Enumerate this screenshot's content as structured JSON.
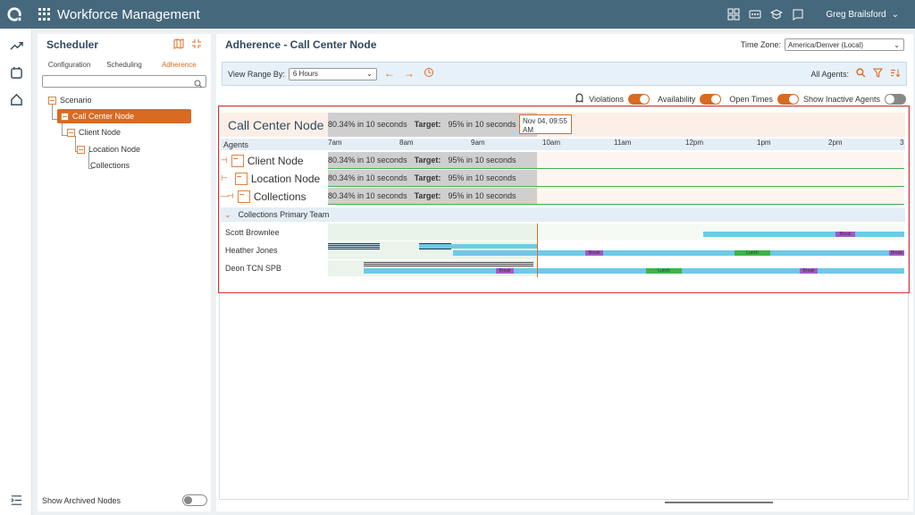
{
  "app": {
    "title": "Workforce Management",
    "user": "Greg Brailsford"
  },
  "panel": {
    "title": "Scheduler",
    "tabs": [
      "Configuration",
      "Scheduling",
      "Adherence"
    ],
    "active_tab": "Adherence",
    "search_placeholder": "",
    "tree": [
      "Scenario",
      "Call Center Node",
      "Client Node",
      "Location Node",
      "Collections"
    ],
    "selected": "Call Center Node",
    "footer": "Show Archived Nodes"
  },
  "main": {
    "title": "Adherence - Call Center Node",
    "tz_label": "Time Zone:",
    "tz_value": "America/Denver (Local)",
    "range_label": "View Range By:",
    "range_value": "6 Hours",
    "all_agents": "All Agents:",
    "toggles": [
      "Violations",
      "Availability",
      "Open Times",
      "Show Inactive Agents"
    ],
    "toggle_states": [
      true,
      true,
      true,
      false
    ]
  },
  "grid": {
    "hours": [
      "7am",
      "8am",
      "9am",
      "10am",
      "11am",
      "12pm",
      "1pm",
      "2pm",
      "3"
    ],
    "agents_header": "Agents",
    "tooltip": "Nov 04, 09:55 AM",
    "ccn": {
      "name": "Call Center Node",
      "stat": "80.34% in 10 seconds",
      "target_label": "Target:",
      "target": "95% in 10 seconds"
    },
    "nodes": [
      {
        "name": "Client Node",
        "stat": "80.34% in 10 seconds",
        "target_label": "Target:",
        "target": "95% in 10 seconds"
      },
      {
        "name": "Location Node",
        "stat": "80.34% in 10 seconds",
        "target_label": "Target:",
        "target": "95% in 10 seconds"
      },
      {
        "name": "Collections",
        "stat": "80.34% in 10 seconds",
        "target_label": "Target:",
        "target": "95% in 10 seconds"
      }
    ],
    "team": "Collections Primary Team",
    "agents": [
      {
        "name": "Scott Brownlee",
        "label": "Break"
      },
      {
        "name": "Heather Jones",
        "labels": [
          "Break",
          "Lunch",
          "Break"
        ]
      },
      {
        "name": "Deon TCN SPB",
        "labels": [
          "Break",
          "Lunch",
          "Break"
        ]
      }
    ]
  }
}
